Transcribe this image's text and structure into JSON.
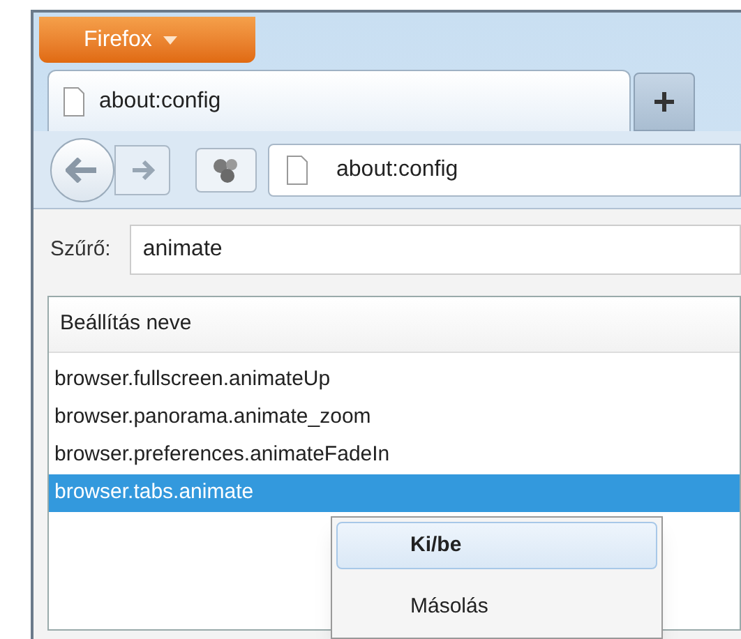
{
  "app_button": {
    "label": "Firefox"
  },
  "tabs": [
    {
      "label": "about:config",
      "selected": true
    }
  ],
  "address_bar": {
    "value": "about:config"
  },
  "filter": {
    "label": "Szűrő:",
    "value": "animate"
  },
  "table": {
    "columns": [
      "Beállítás neve"
    ],
    "rows": [
      {
        "name": "browser.fullscreen.animateUp",
        "selected": false
      },
      {
        "name": "browser.panorama.animate_zoom",
        "selected": false
      },
      {
        "name": "browser.preferences.animateFadeIn",
        "selected": false
      },
      {
        "name": "browser.tabs.animate",
        "selected": true
      }
    ]
  },
  "context_menu": {
    "items": [
      {
        "label": "Ki/be",
        "selected": true
      },
      {
        "label": "Másolás",
        "selected": false
      }
    ]
  }
}
